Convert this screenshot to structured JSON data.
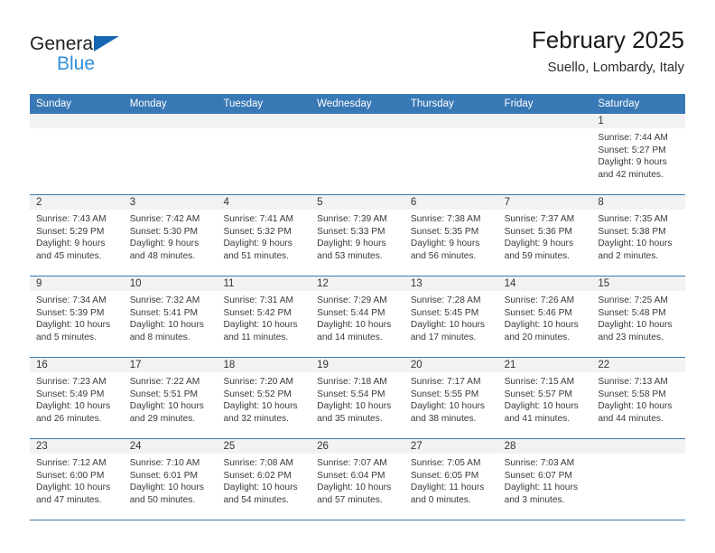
{
  "brand": {
    "word1": "General",
    "word2": "Blue",
    "accent_color": "#2f8fd8",
    "triangle_color": "#1567b3"
  },
  "header": {
    "title": "February 2025",
    "subtitle": "Suello, Lombardy, Italy",
    "header_bg_color": "#3878b4",
    "header_text_color": "#ffffff"
  },
  "weekdays": [
    "Sunday",
    "Monday",
    "Tuesday",
    "Wednesday",
    "Thursday",
    "Friday",
    "Saturday"
  ],
  "weeks": [
    [
      {
        "day": "",
        "empty": true
      },
      {
        "day": "",
        "empty": true
      },
      {
        "day": "",
        "empty": true
      },
      {
        "day": "",
        "empty": true
      },
      {
        "day": "",
        "empty": true
      },
      {
        "day": "",
        "empty": true
      },
      {
        "day": "1",
        "sunrise": "Sunrise: 7:44 AM",
        "sunset": "Sunset: 5:27 PM",
        "daylight1": "Daylight: 9 hours",
        "daylight2": "and 42 minutes."
      }
    ],
    [
      {
        "day": "2",
        "sunrise": "Sunrise: 7:43 AM",
        "sunset": "Sunset: 5:29 PM",
        "daylight1": "Daylight: 9 hours",
        "daylight2": "and 45 minutes."
      },
      {
        "day": "3",
        "sunrise": "Sunrise: 7:42 AM",
        "sunset": "Sunset: 5:30 PM",
        "daylight1": "Daylight: 9 hours",
        "daylight2": "and 48 minutes."
      },
      {
        "day": "4",
        "sunrise": "Sunrise: 7:41 AM",
        "sunset": "Sunset: 5:32 PM",
        "daylight1": "Daylight: 9 hours",
        "daylight2": "and 51 minutes."
      },
      {
        "day": "5",
        "sunrise": "Sunrise: 7:39 AM",
        "sunset": "Sunset: 5:33 PM",
        "daylight1": "Daylight: 9 hours",
        "daylight2": "and 53 minutes."
      },
      {
        "day": "6",
        "sunrise": "Sunrise: 7:38 AM",
        "sunset": "Sunset: 5:35 PM",
        "daylight1": "Daylight: 9 hours",
        "daylight2": "and 56 minutes."
      },
      {
        "day": "7",
        "sunrise": "Sunrise: 7:37 AM",
        "sunset": "Sunset: 5:36 PM",
        "daylight1": "Daylight: 9 hours",
        "daylight2": "and 59 minutes."
      },
      {
        "day": "8",
        "sunrise": "Sunrise: 7:35 AM",
        "sunset": "Sunset: 5:38 PM",
        "daylight1": "Daylight: 10 hours",
        "daylight2": "and 2 minutes."
      }
    ],
    [
      {
        "day": "9",
        "sunrise": "Sunrise: 7:34 AM",
        "sunset": "Sunset: 5:39 PM",
        "daylight1": "Daylight: 10 hours",
        "daylight2": "and 5 minutes."
      },
      {
        "day": "10",
        "sunrise": "Sunrise: 7:32 AM",
        "sunset": "Sunset: 5:41 PM",
        "daylight1": "Daylight: 10 hours",
        "daylight2": "and 8 minutes."
      },
      {
        "day": "11",
        "sunrise": "Sunrise: 7:31 AM",
        "sunset": "Sunset: 5:42 PM",
        "daylight1": "Daylight: 10 hours",
        "daylight2": "and 11 minutes."
      },
      {
        "day": "12",
        "sunrise": "Sunrise: 7:29 AM",
        "sunset": "Sunset: 5:44 PM",
        "daylight1": "Daylight: 10 hours",
        "daylight2": "and 14 minutes."
      },
      {
        "day": "13",
        "sunrise": "Sunrise: 7:28 AM",
        "sunset": "Sunset: 5:45 PM",
        "daylight1": "Daylight: 10 hours",
        "daylight2": "and 17 minutes."
      },
      {
        "day": "14",
        "sunrise": "Sunrise: 7:26 AM",
        "sunset": "Sunset: 5:46 PM",
        "daylight1": "Daylight: 10 hours",
        "daylight2": "and 20 minutes."
      },
      {
        "day": "15",
        "sunrise": "Sunrise: 7:25 AM",
        "sunset": "Sunset: 5:48 PM",
        "daylight1": "Daylight: 10 hours",
        "daylight2": "and 23 minutes."
      }
    ],
    [
      {
        "day": "16",
        "sunrise": "Sunrise: 7:23 AM",
        "sunset": "Sunset: 5:49 PM",
        "daylight1": "Daylight: 10 hours",
        "daylight2": "and 26 minutes."
      },
      {
        "day": "17",
        "sunrise": "Sunrise: 7:22 AM",
        "sunset": "Sunset: 5:51 PM",
        "daylight1": "Daylight: 10 hours",
        "daylight2": "and 29 minutes."
      },
      {
        "day": "18",
        "sunrise": "Sunrise: 7:20 AM",
        "sunset": "Sunset: 5:52 PM",
        "daylight1": "Daylight: 10 hours",
        "daylight2": "and 32 minutes."
      },
      {
        "day": "19",
        "sunrise": "Sunrise: 7:18 AM",
        "sunset": "Sunset: 5:54 PM",
        "daylight1": "Daylight: 10 hours",
        "daylight2": "and 35 minutes."
      },
      {
        "day": "20",
        "sunrise": "Sunrise: 7:17 AM",
        "sunset": "Sunset: 5:55 PM",
        "daylight1": "Daylight: 10 hours",
        "daylight2": "and 38 minutes."
      },
      {
        "day": "21",
        "sunrise": "Sunrise: 7:15 AM",
        "sunset": "Sunset: 5:57 PM",
        "daylight1": "Daylight: 10 hours",
        "daylight2": "and 41 minutes."
      },
      {
        "day": "22",
        "sunrise": "Sunrise: 7:13 AM",
        "sunset": "Sunset: 5:58 PM",
        "daylight1": "Daylight: 10 hours",
        "daylight2": "and 44 minutes."
      }
    ],
    [
      {
        "day": "23",
        "sunrise": "Sunrise: 7:12 AM",
        "sunset": "Sunset: 6:00 PM",
        "daylight1": "Daylight: 10 hours",
        "daylight2": "and 47 minutes."
      },
      {
        "day": "24",
        "sunrise": "Sunrise: 7:10 AM",
        "sunset": "Sunset: 6:01 PM",
        "daylight1": "Daylight: 10 hours",
        "daylight2": "and 50 minutes."
      },
      {
        "day": "25",
        "sunrise": "Sunrise: 7:08 AM",
        "sunset": "Sunset: 6:02 PM",
        "daylight1": "Daylight: 10 hours",
        "daylight2": "and 54 minutes."
      },
      {
        "day": "26",
        "sunrise": "Sunrise: 7:07 AM",
        "sunset": "Sunset: 6:04 PM",
        "daylight1": "Daylight: 10 hours",
        "daylight2": "and 57 minutes."
      },
      {
        "day": "27",
        "sunrise": "Sunrise: 7:05 AM",
        "sunset": "Sunset: 6:05 PM",
        "daylight1": "Daylight: 11 hours",
        "daylight2": "and 0 minutes."
      },
      {
        "day": "28",
        "sunrise": "Sunrise: 7:03 AM",
        "sunset": "Sunset: 6:07 PM",
        "daylight1": "Daylight: 11 hours",
        "daylight2": "and 3 minutes."
      },
      {
        "day": "",
        "empty": true
      }
    ]
  ]
}
